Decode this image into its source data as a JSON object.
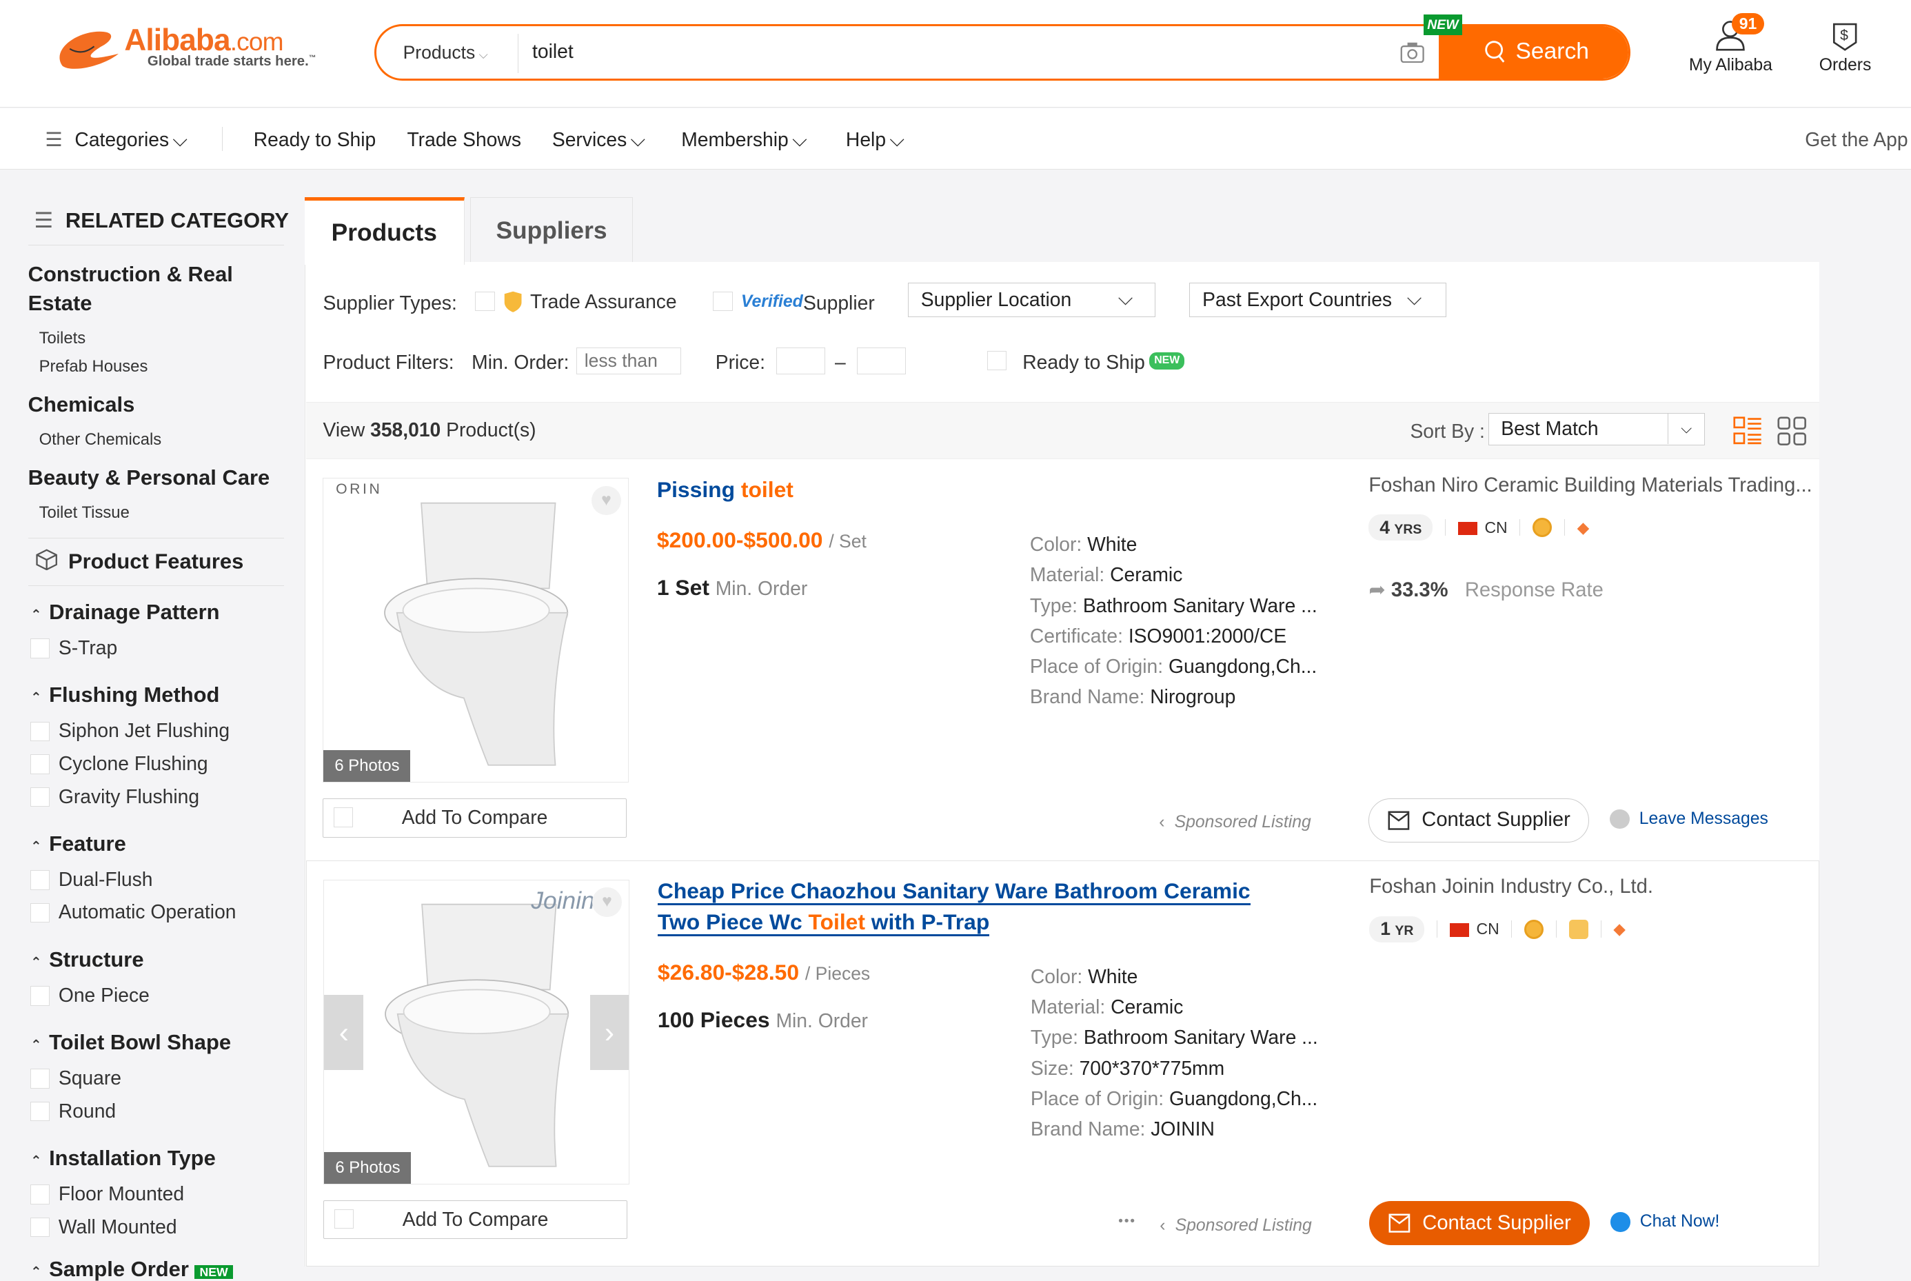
{
  "brand": {
    "name": "Alibaba",
    "suffix": ".com",
    "tagline": "Global trade starts here.",
    "tm": "™",
    "colors": {
      "accent": "#ff6a00",
      "link": "#004a9c",
      "new_badge": "#0a9a2f"
    }
  },
  "search": {
    "category": "Products",
    "query": "toilet",
    "button": "Search",
    "new_badge": "NEW",
    "icons": [
      "camera-icon",
      "search-icon"
    ]
  },
  "header": {
    "my_alibaba": "My Alibaba",
    "notifications": "91",
    "orders": "Orders"
  },
  "nav": {
    "categories": "Categories",
    "items": [
      "Ready to Ship",
      "Trade Shows",
      "Services",
      "Membership",
      "Help"
    ],
    "get_app": "Get the App"
  },
  "sidebar": {
    "related_title": "RELATED CATEGORY",
    "groups": [
      {
        "title": "Construction & Real Estate",
        "items": [
          "Toilets",
          "Prefab Houses"
        ]
      },
      {
        "title": "Chemicals",
        "items": [
          "Other Chemicals"
        ]
      },
      {
        "title": "Beauty & Personal Care",
        "items": [
          "Toilet Tissue"
        ]
      }
    ],
    "features_title": "Product Features",
    "features": [
      {
        "title": "Drainage Pattern",
        "options": [
          "S-Trap"
        ]
      },
      {
        "title": "Flushing Method",
        "options": [
          "Siphon Jet Flushing",
          "Cyclone Flushing",
          "Gravity Flushing"
        ]
      },
      {
        "title": "Feature",
        "options": [
          "Dual-Flush",
          "Automatic Operation"
        ]
      },
      {
        "title": "Structure",
        "options": [
          "One Piece"
        ]
      },
      {
        "title": "Toilet Bowl Shape",
        "options": [
          "Square",
          "Round"
        ]
      },
      {
        "title": "Installation Type",
        "options": [
          "Floor Mounted",
          "Wall Mounted"
        ]
      }
    ],
    "next_section": "Sample Order",
    "next_badge": "NEW"
  },
  "tabs": [
    {
      "label": "Products",
      "active": true
    },
    {
      "label": "Suppliers",
      "active": false
    }
  ],
  "filters": {
    "supplier_types_label": "Supplier Types:",
    "trade_assurance": "Trade Assurance",
    "verified": "Verified",
    "supplier": "Supplier",
    "supplier_location": "Supplier Location",
    "past_export": "Past Export Countries",
    "product_filters_label": "Product Filters:",
    "min_order_label": "Min. Order:",
    "min_order_placeholder": "less than",
    "price_label": "Price:",
    "price_dash": "–",
    "ready_to_ship": "Ready to Ship",
    "ready_badge": "NEW"
  },
  "results": {
    "view": "View",
    "count": "358,010",
    "suffix": "Product(s)",
    "sort_label": "Sort By :",
    "sort_value": "Best Match"
  },
  "listings": [
    {
      "title_pre": "Pissing ",
      "title_hl": "toilet",
      "title_post": "",
      "price": "$200.00-$500.00",
      "unit": "/ Set",
      "moq": "1 Set",
      "moq_label": "Min. Order",
      "attrs": [
        {
          "k": "Color:",
          "v": "White"
        },
        {
          "k": "Material:",
          "v": "Ceramic"
        },
        {
          "k": "Type:",
          "v": "Bathroom Sanitary Ware ..."
        },
        {
          "k": "Certificate:",
          "v": "ISO9001:2000/CE"
        },
        {
          "k": "Place of Origin:",
          "v": "Guangdong,Ch..."
        },
        {
          "k": "Brand Name:",
          "v": "Nirogroup"
        }
      ],
      "supplier": "Foshan Niro Ceramic Building Materials Trading...",
      "years": "4",
      "years_unit": "YRS",
      "country": "CN",
      "response_rate": "33.3%",
      "response_label": "Response Rate",
      "photos": "6 Photos",
      "compare": "Add To Compare",
      "sponsored": "Sponsored Listing",
      "contact": "Contact Supplier",
      "message": "Leave Messages",
      "image_brand": "ORIN"
    },
    {
      "title_pre": "Cheap Price Chaozhou Sanitary Ware Bathroom Ceramic Two Piece Wc ",
      "title_hl": "Toilet",
      "title_post": " with P-Trap",
      "price": "$26.80-$28.50",
      "unit": "/ Pieces",
      "moq": "100 Pieces",
      "moq_label": "Min. Order",
      "attrs": [
        {
          "k": "Color:",
          "v": "White"
        },
        {
          "k": "Material:",
          "v": "Ceramic"
        },
        {
          "k": "Type:",
          "v": "Bathroom Sanitary Ware ..."
        },
        {
          "k": "Size:",
          "v": "700*370*775mm"
        },
        {
          "k": "Place of Origin:",
          "v": "Guangdong,Ch..."
        },
        {
          "k": "Brand Name:",
          "v": "JOININ"
        }
      ],
      "supplier": "Foshan Joinin Industry Co., Ltd.",
      "years": "1",
      "years_unit": "YR",
      "country": "CN",
      "photos": "6 Photos",
      "compare": "Add To Compare",
      "sponsored": "Sponsored Listing",
      "more": "•••",
      "contact": "Contact Supplier",
      "message": "Chat Now!",
      "image_brand": "Joinin"
    }
  ]
}
